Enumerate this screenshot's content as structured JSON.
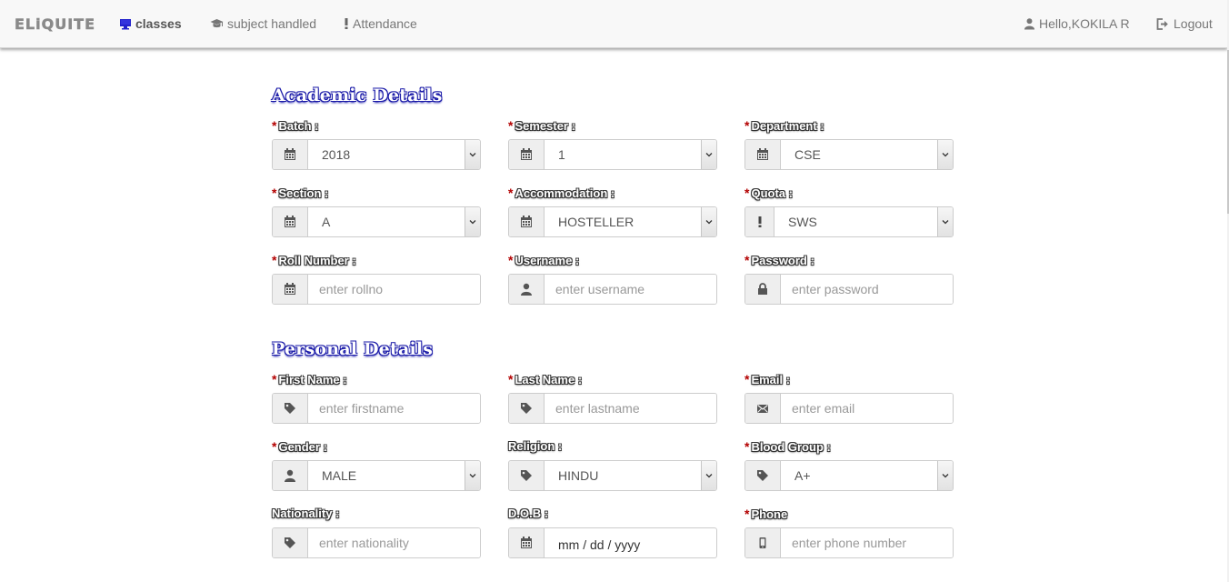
{
  "navbar": {
    "brand": "ELiQUITE",
    "items": [
      {
        "label": "classes",
        "icon": "monitor-icon",
        "active": true
      },
      {
        "label": "subject handled",
        "icon": "graduation-cap-icon",
        "active": false
      },
      {
        "label": "Attendance",
        "icon": "exclamation-icon",
        "active": false
      }
    ],
    "user_greeting": "Hello,KOKILA R",
    "logout_label": "Logout"
  },
  "academic": {
    "title": "Academic Details",
    "batch": {
      "label": "Batch :",
      "required": "*",
      "value": "2018",
      "icon": "calendar-icon"
    },
    "semester": {
      "label": "Semester :",
      "required": "*",
      "value": "1",
      "icon": "calendar-icon"
    },
    "department": {
      "label": "Department :",
      "required": "*",
      "value": "CSE",
      "icon": "calendar-icon"
    },
    "section": {
      "label": "Section :",
      "required": "*",
      "value": "A",
      "icon": "calendar-icon"
    },
    "accommodation": {
      "label": "Accommodation :",
      "required": "*",
      "value": "HOSTELLER",
      "icon": "calendar-icon"
    },
    "quota": {
      "label": "Quota :",
      "required": "*",
      "value": "SWS",
      "icon": "exclamation-icon"
    },
    "rollno": {
      "label": "Roll Number :",
      "required": "*",
      "placeholder": "enter rollno",
      "icon": "calendar-icon"
    },
    "username": {
      "label": "Username :",
      "required": "*",
      "placeholder": "enter username",
      "icon": "user-icon"
    },
    "password": {
      "label": "Password :",
      "required": "*",
      "placeholder": "enter password",
      "icon": "lock-icon"
    }
  },
  "personal": {
    "title": "Personal Details",
    "firstname": {
      "label": "First Name :",
      "required": "*",
      "placeholder": "enter firstname",
      "icon": "tag-icon"
    },
    "lastname": {
      "label": "Last Name :",
      "required": "*",
      "placeholder": "enter lastname",
      "icon": "tag-icon"
    },
    "email": {
      "label": "Email :",
      "required": "*",
      "placeholder": "enter email",
      "icon": "envelope-icon"
    },
    "gender": {
      "label": "Gender :",
      "required": "*",
      "value": "MALE",
      "icon": "user-icon"
    },
    "religion": {
      "label": "Religion :",
      "value": "HINDU",
      "icon": "tag-icon"
    },
    "bloodgroup": {
      "label": "Blood Group :",
      "required": "*",
      "value": "A+",
      "icon": "tag-icon"
    },
    "nationality": {
      "label": "Nationality :",
      "placeholder": "enter nationality",
      "icon": "tag-icon"
    },
    "dob": {
      "label": "D.O.B :",
      "value": "mm / dd / yyyy",
      "icon": "calendar-icon"
    },
    "phone": {
      "label": "Phone",
      "required": "*",
      "placeholder": "enter phone number",
      "icon": "phone-icon"
    }
  },
  "colors": {
    "heading_blue": "#1a1aa8",
    "required_red": "#b30000",
    "navbar_bg": "#f8f8f8",
    "addon_bg": "#eeeeee"
  }
}
